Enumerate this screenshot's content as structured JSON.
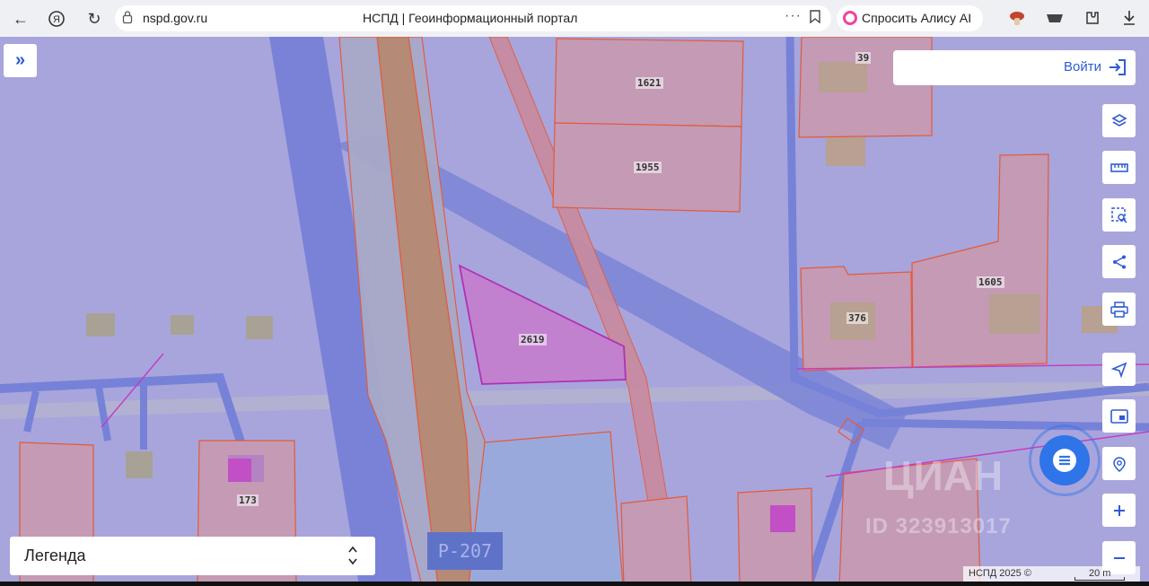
{
  "browser": {
    "url": "nspd.gov.ru",
    "tab_title": "НСПД | Геоинформационный портал",
    "alice_label": "Спросить Алису AI",
    "more_icon": "···"
  },
  "map": {
    "login_label": "Войти",
    "legend_label": "Легенда",
    "copyright": "НСПД 2025 ©",
    "scale": "20 m",
    "road_label": "Р-207",
    "parcels": [
      {
        "id": "p1621",
        "label": "1621"
      },
      {
        "id": "p1955",
        "label": "1955"
      },
      {
        "id": "p39",
        "label": "39"
      },
      {
        "id": "p1605",
        "label": "1605"
      },
      {
        "id": "p376",
        "label": "376"
      },
      {
        "id": "p2619",
        "label": "2619"
      },
      {
        "id": "p173",
        "label": "173"
      }
    ],
    "watermark": {
      "logo": "ЦИАН",
      "id": "ID 323913017"
    },
    "tools": [
      "layers-icon",
      "ruler-icon",
      "area-select-icon",
      "share-icon",
      "print-icon",
      "location-icon",
      "minimap-icon",
      "geo-search-icon",
      "zoom-in-icon",
      "zoom-out-icon"
    ],
    "accent_color": "#2f5bd3"
  }
}
